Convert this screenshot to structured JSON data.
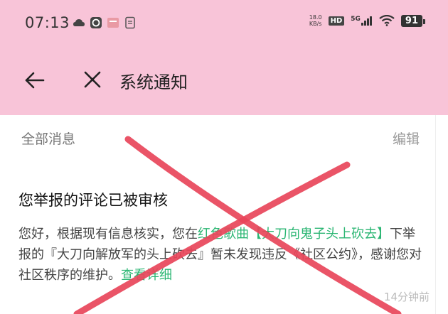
{
  "status_bar": {
    "time": "07:13",
    "left_icons": [
      "cloud-icon",
      "netease-icon",
      "app-icon",
      "document-icon"
    ],
    "net_speed_value": "18.0",
    "net_speed_unit": "KB/s",
    "hd_label": "HD",
    "signal_label": "5G",
    "battery": "91"
  },
  "header": {
    "title": "系统通知"
  },
  "filter": {
    "all_messages": "全部消息",
    "edit": "编辑"
  },
  "notification": {
    "title": "您举报的评论已被审核",
    "body_prefix": "您好，根据现有信息核实，您在",
    "song_link": "红色歌曲【大刀向鬼子头上砍去】",
    "body_middle": "下举报的『大刀向解放军的头上砍去』暂未发现违反《社区公约》，感谢您对社区秩序的维护。",
    "details_link": "查看详细",
    "time_ago": "14分钟前"
  },
  "colors": {
    "header_bg": "#f8c4d8",
    "link": "#2bb673",
    "overlay_x": "#e8455a"
  }
}
